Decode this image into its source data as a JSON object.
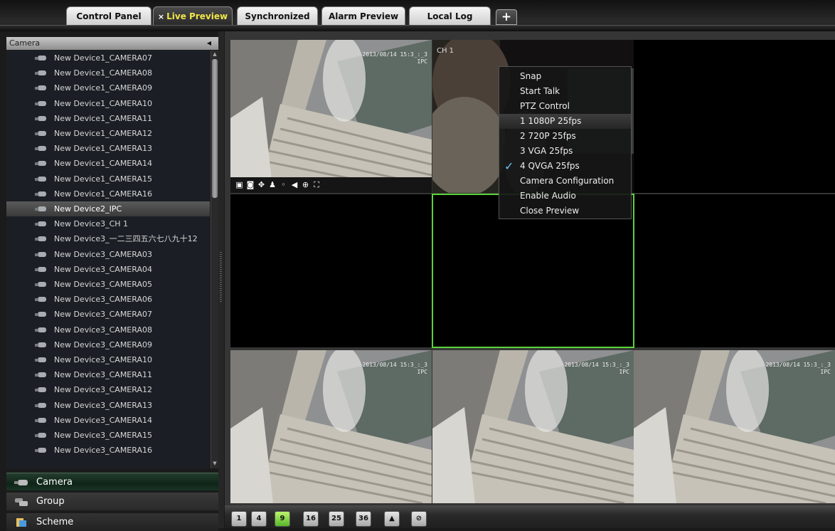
{
  "tabs": [
    {
      "label": "Control Panel",
      "active": false
    },
    {
      "label": "Live Preview",
      "active": true
    },
    {
      "label": "Synchronized",
      "active": false
    },
    {
      "label": "Alarm Preview",
      "active": false
    },
    {
      "label": "Local Log",
      "active": false
    }
  ],
  "add_tab_label": "+",
  "close_glyph": "×",
  "camera_panel": {
    "header": "Camera",
    "items": [
      "New Device1_CAMERA07",
      "New Device1_CAMERA08",
      "New Device1_CAMERA09",
      "New Device1_CAMERA10",
      "New Device1_CAMERA11",
      "New Device1_CAMERA12",
      "New Device1_CAMERA13",
      "New Device1_CAMERA14",
      "New Device1_CAMERA15",
      "New Device1_CAMERA16",
      "New Device2_IPC",
      "New Device3_CH 1",
      "New Device3_一二三四五六七八九十12",
      "New Device3_CAMERA03",
      "New Device3_CAMERA04",
      "New Device3_CAMERA05",
      "New Device3_CAMERA06",
      "New Device3_CAMERA07",
      "New Device3_CAMERA08",
      "New Device3_CAMERA09",
      "New Device3_CAMERA10",
      "New Device3_CAMERA11",
      "New Device3_CAMERA12",
      "New Device3_CAMERA13",
      "New Device3_CAMERA14",
      "New Device3_CAMERA15",
      "New Device3_CAMERA16"
    ],
    "selected_item": "New Device2_IPC"
  },
  "nav": {
    "camera": "Camera",
    "group": "Group",
    "scheme": "Scheme"
  },
  "grid": {
    "timestamp": "2013/08/14 15:3_:_3",
    "ipc_label": "IPC",
    "ch_label": "CH 1"
  },
  "context_menu": {
    "items": [
      "Snap",
      "Start Talk",
      "PTZ Control",
      "1 1080P 25fps",
      "2 720P 25fps",
      "3 VGA 25fps",
      "4 QVGA 25fps",
      "Camera Configuration",
      "Enable Audio",
      "Close Preview"
    ],
    "highlighted": "1 1080P 25fps",
    "checked": "4 QVGA 25fps"
  },
  "layout_buttons": [
    "1",
    "4",
    "9",
    "16",
    "25",
    "36"
  ],
  "active_layout": "9",
  "colors": {
    "selection_outline": "#5cd43a",
    "active_tab_text": "#f2e64a",
    "menu_check": "#6dc0f0"
  }
}
